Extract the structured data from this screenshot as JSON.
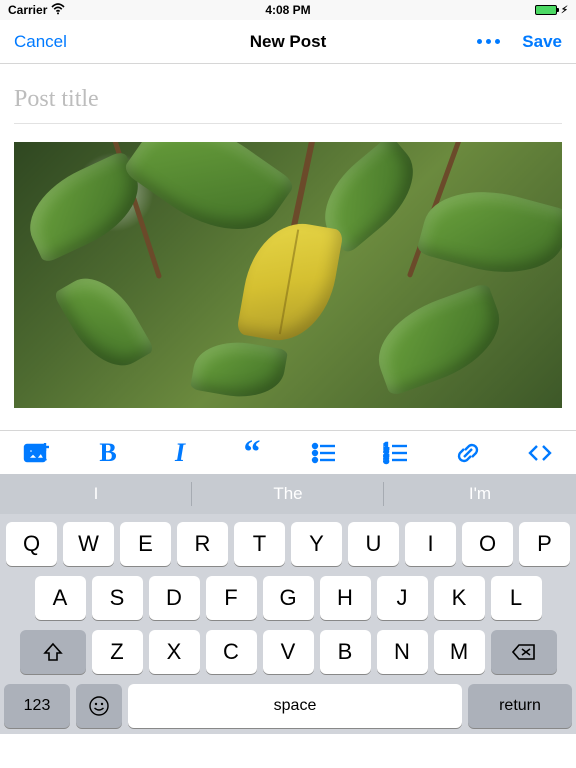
{
  "status": {
    "carrier": "Carrier",
    "time": "4:08 PM"
  },
  "nav": {
    "cancel": "Cancel",
    "title": "New Post",
    "save": "Save"
  },
  "post": {
    "title_placeholder": "Post title"
  },
  "toolbar": {
    "image": "image-add",
    "bold": "B",
    "italic": "I",
    "quote": "“",
    "ul": "ul",
    "ol": "ol",
    "link": "link",
    "code": "code"
  },
  "suggestions": [
    "I",
    "The",
    "I'm"
  ],
  "keyboard": {
    "row1": [
      "Q",
      "W",
      "E",
      "R",
      "T",
      "Y",
      "U",
      "I",
      "O",
      "P"
    ],
    "row2": [
      "A",
      "S",
      "D",
      "F",
      "G",
      "H",
      "J",
      "K",
      "L"
    ],
    "row3": [
      "Z",
      "X",
      "C",
      "V",
      "B",
      "N",
      "M"
    ],
    "numKey": "123",
    "space": "space",
    "return": "return"
  }
}
